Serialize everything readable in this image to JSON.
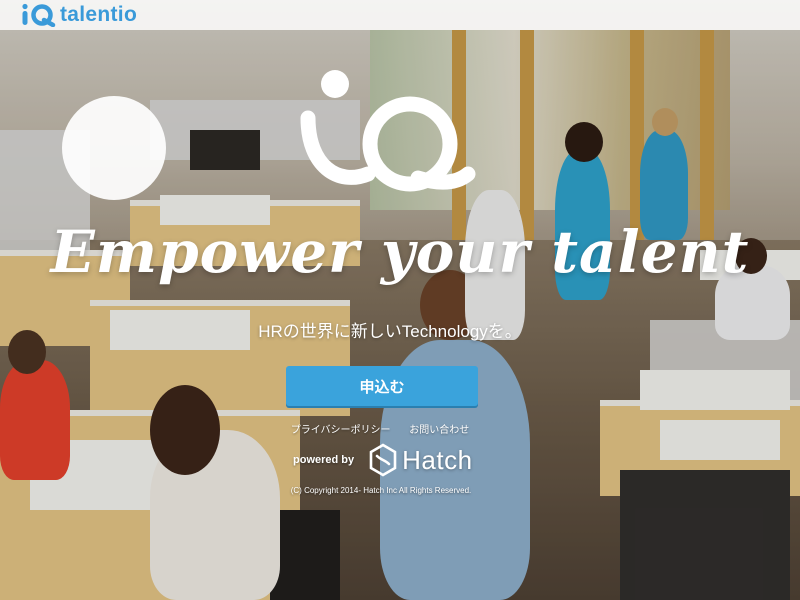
{
  "header": {
    "brand_name": "talentio",
    "logo_icon": "iq-logo-icon",
    "brand_color": "#3a9ad9"
  },
  "hero": {
    "logo_icon": "iq-logo-large-icon",
    "tagline": "Empower your talent",
    "subtitle": "HRの世界に新しいTechnologyを。",
    "apply_button_label": "申込む",
    "button_color": "#3aa3dc"
  },
  "footer": {
    "links": [
      {
        "label": "プライバシーポリシー"
      },
      {
        "label": "お問い合わせ"
      }
    ],
    "powered_by_label": "powered by",
    "partner_name": "Hatch",
    "partner_icon": "hatch-logo-icon",
    "copyright": "(C) Copyright 2014- Hatch Inc All Rights Reserved."
  }
}
